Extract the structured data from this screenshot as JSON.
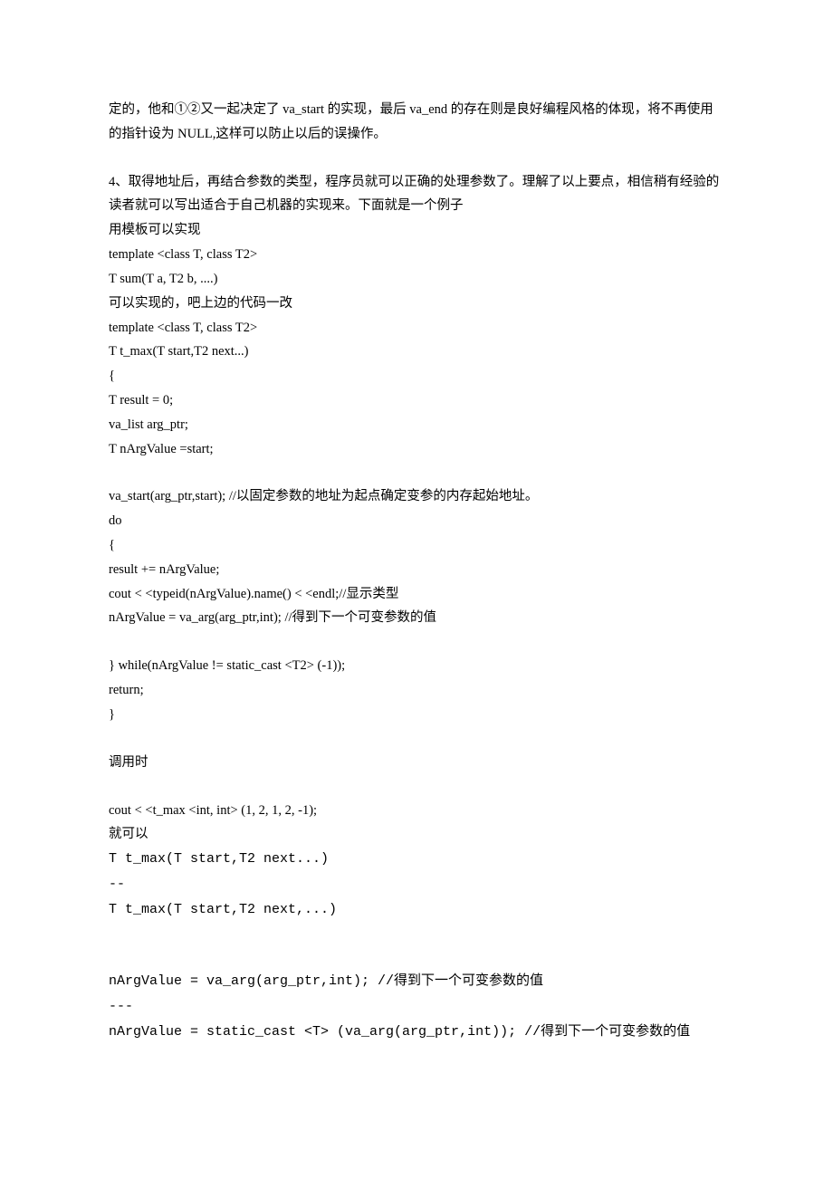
{
  "intro": {
    "line1": "定的，他和①②又一起决定了 va_start 的实现，最后 va_end 的存在则是良好编程风格的体现，将不再使用的指针设为 NULL,这样可以防止以后的误操作。"
  },
  "section4": {
    "para1": "4、取得地址后，再结合参数的类型，程序员就可以正确的处理参数了。理解了以上要点，相信稍有经验的读者就可以写出适合于自己机器的实现来。下面就是一个例子",
    "line_useTemplate": "用模板可以实现",
    "code1_l1": "template <class   T,   class   T2>",
    "code1_l2": "T   sum(T   a,   T2   b,   ....)",
    "line_canImplement": "可以实现的，吧上边的代码一改",
    "code2_l1": "template <class   T,   class   T2>",
    "code2_l2": "T   t_max(T   start,T2   next...)",
    "code2_l3": "{",
    "code2_l4": "        T   result   =   0;",
    "code2_l5": "        va_list   arg_ptr;",
    "code2_l6": "        T   nArgValue   =start;",
    "code2_l7": "        va_start(arg_ptr,start);   //以固定参数的地址为起点确定变参的内存起始地址。",
    "code2_l8": "        do",
    "code2_l9": "        {",
    "code2_l10": "              result   +=   nArgValue;",
    "code2_l11": "              cout < <typeid(nArgValue).name() < <endl;//显示类型",
    "code2_l12": "                nArgValue   =   va_arg(arg_ptr,int);       //得到下一个可变参数的值",
    "code2_l13": "        }   while(nArgValue   !=   static_cast <T2> (-1));",
    "code2_l14": "        return;",
    "code2_l15": "}"
  },
  "call": {
    "heading": "调用时",
    "line1": "cout < <t_max <int,   int> (1,   2,   1,   2,   -1);",
    "line2": "就可以",
    "mono1": "T     t_max(T     start,T2     next...)",
    "dash1": "--",
    "mono2": "T     t_max(T     start,T2     next,...)",
    "mono3": "nArgValue     =     va_arg(arg_ptr,int);             //得到下一个可变参数的值",
    "dash2": "---",
    "mono4": "nArgValue     =     static_cast <T> (va_arg(arg_ptr,int));         //得到下一个可变参数的值"
  }
}
